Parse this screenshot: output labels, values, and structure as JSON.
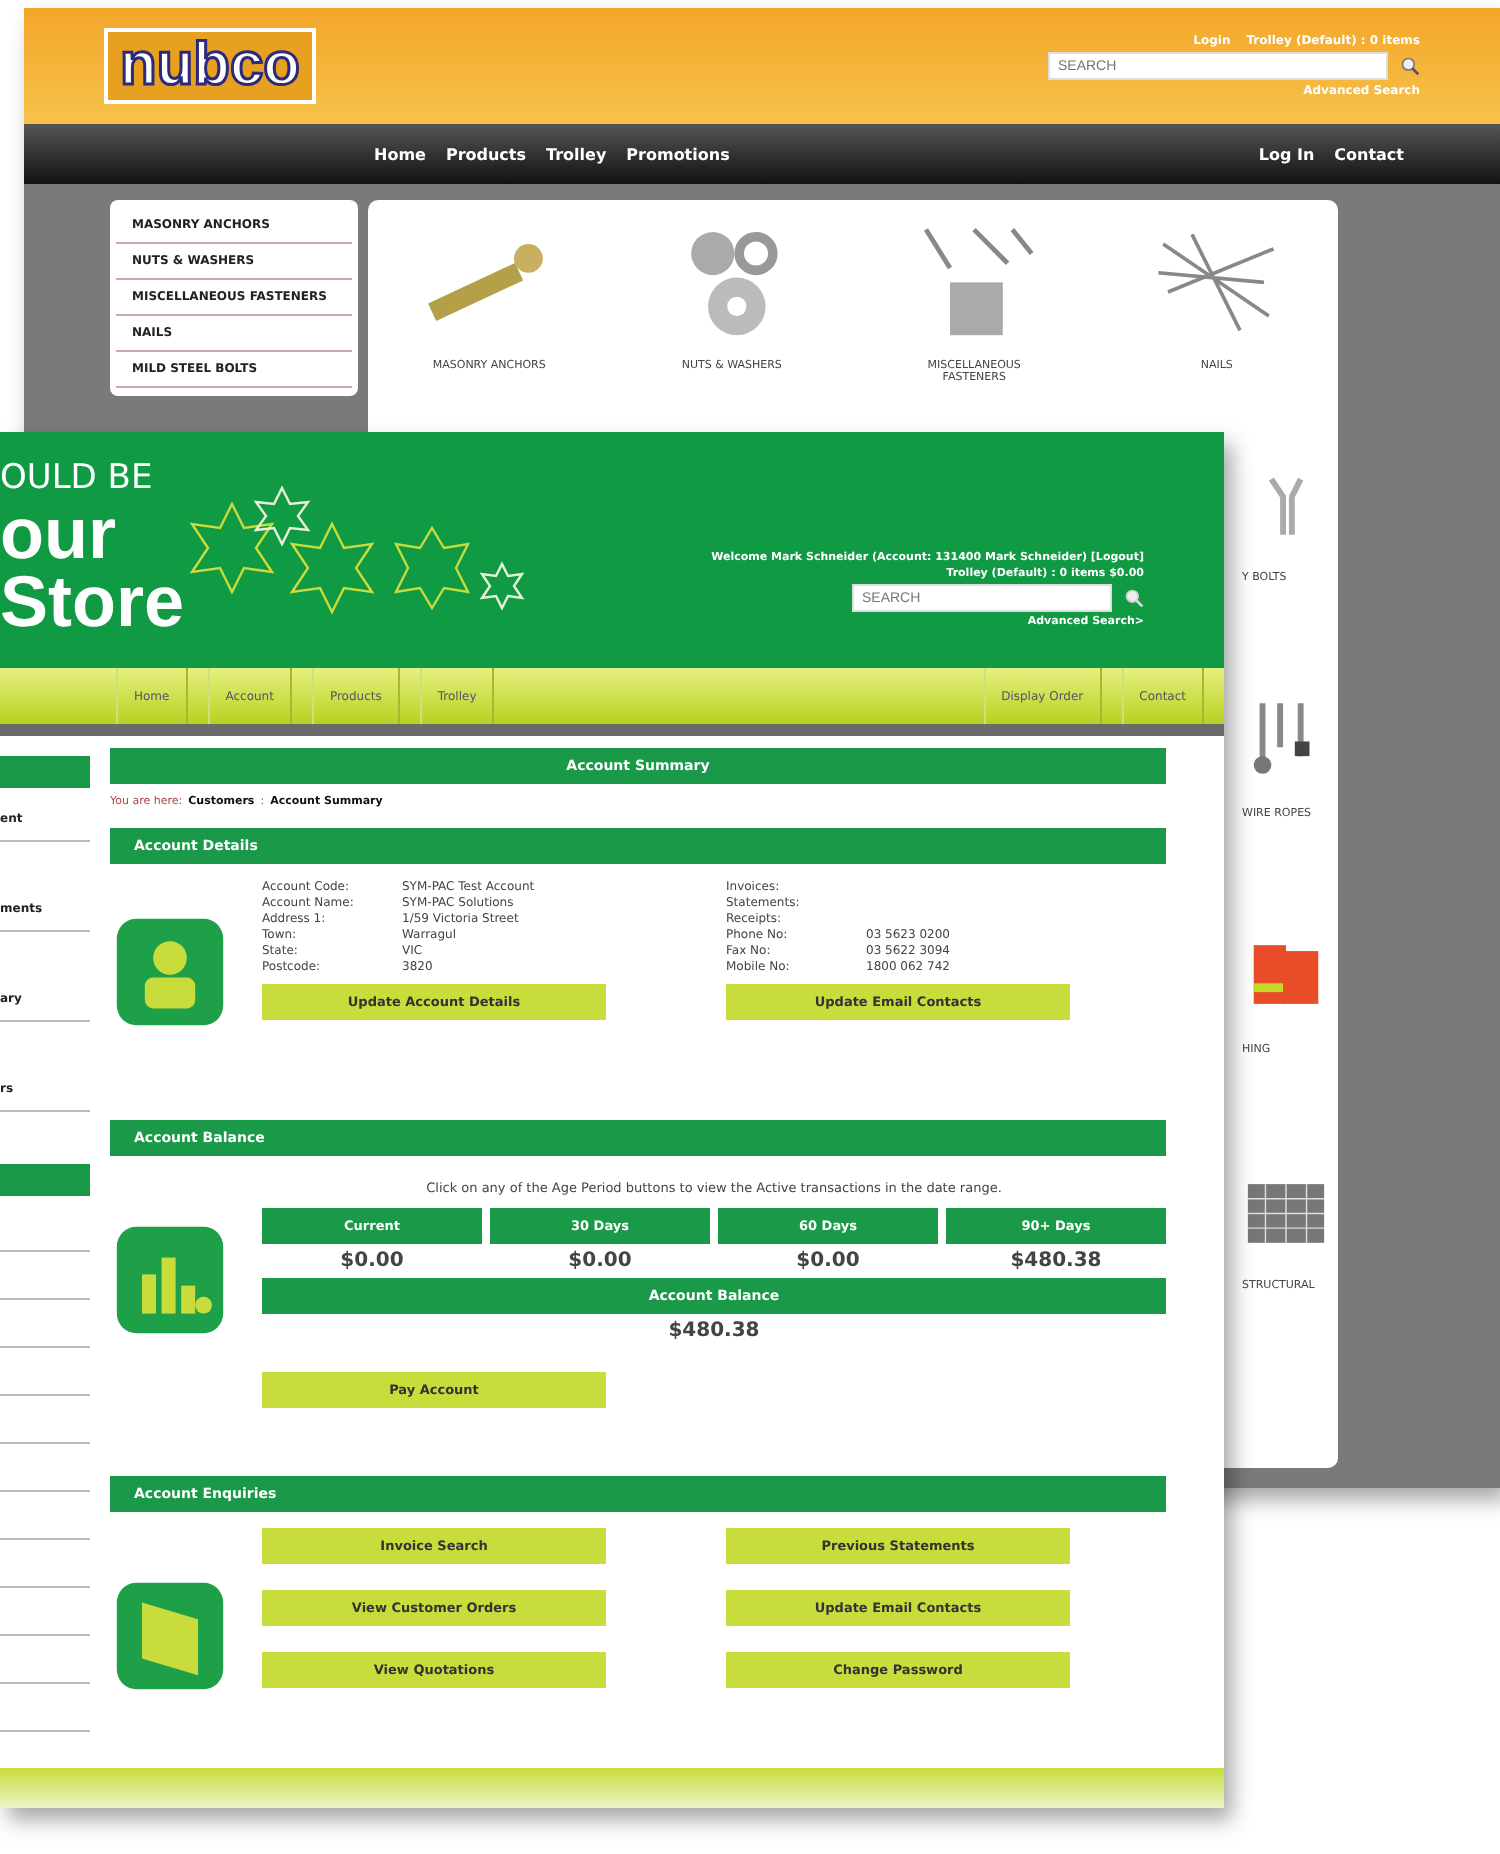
{
  "back_window": {
    "logo": "nubco",
    "header_links": [
      "Login",
      "Trolley (Default) : 0 items"
    ],
    "search": {
      "placeholder": "SEARCH"
    },
    "advanced_search": "Advanced Search",
    "nav_left": [
      "Home",
      "Products",
      "Trolley",
      "Promotions"
    ],
    "nav_right": [
      "Log In",
      "Contact"
    ],
    "sidebar": [
      "MASONRY ANCHORS",
      "NUTS & WASHERS",
      "MISCELLANEOUS FASTENERS",
      "NAILS",
      "MILD STEEL BOLTS"
    ],
    "products": [
      {
        "caption": "MASONRY ANCHORS",
        "kind": "anchor"
      },
      {
        "caption": "NUTS & WASHERS",
        "kind": "nut"
      },
      {
        "caption": "MISCELLANEOUS FASTENERS",
        "kind": "misc"
      },
      {
        "caption": "NAILS",
        "kind": "nails"
      },
      {
        "caption": "Y BOLTS",
        "kind": "bolts"
      },
      {
        "caption": "WIRE ROPES",
        "kind": "ropes"
      },
      {
        "caption": "HING",
        "kind": "clothing"
      },
      {
        "caption": "STRUCTURAL",
        "kind": "mesh"
      }
    ]
  },
  "front_window": {
    "banner": [
      "OULD BE",
      "our",
      "Store"
    ],
    "welcome": "Welcome Mark Schneider (Account: 131400 Mark Schneider) [Logout]",
    "trolley": "Trolley (Default) : 0 items  $0.00",
    "search": {
      "placeholder": "SEARCH"
    },
    "advanced_search": "Advanced Search>",
    "nav_left": [
      "Home",
      "Account",
      "Products",
      "Trolley"
    ],
    "nav_right": [
      "Display Order",
      "Contact"
    ],
    "sidebar": [
      "ent",
      "ments",
      "ary",
      "rs"
    ],
    "page_title": "Account Summary",
    "breadcrumb": {
      "prefix": "You are here:",
      "separator": ":",
      "trail": [
        "Customers",
        "Account Summary"
      ]
    },
    "details": {
      "title": "Account Details",
      "fields": [
        {
          "label": "Account Code:",
          "value": "SYM-PAC Test Account"
        },
        {
          "label": "Account Name:",
          "value": "SYM-PAC Solutions"
        },
        {
          "label": "Address 1:",
          "value": "1/59 Victoria Street"
        },
        {
          "label": "Town:",
          "value": "Warragul"
        },
        {
          "label": "State:",
          "value": "VIC"
        },
        {
          "label": "Postcode:",
          "value": "3820"
        }
      ],
      "contact_fields": [
        {
          "label": "Invoices:"
        },
        {
          "label": "Statements:"
        },
        {
          "label": "Receipts:"
        },
        {
          "label": "Phone No:",
          "value": "03 5623 0200"
        },
        {
          "label": "Fax No:",
          "value": "03 5622 3094"
        },
        {
          "label": "Mobile No:",
          "value": "1800 062 742"
        }
      ],
      "buttons": [
        "Update Account Details",
        "Update Email Contacts"
      ]
    },
    "balance": {
      "title": "Account Balance",
      "instruction": "Click on any of the Age Period buttons to view the Active transactions in the date range.",
      "periods": [
        {
          "label": "Current",
          "amount": "$0.00"
        },
        {
          "label": "30 Days",
          "amount": "$0.00"
        },
        {
          "label": "60 Days",
          "amount": "$0.00"
        },
        {
          "label": "90+ Days",
          "amount": "$480.38"
        }
      ],
      "total_label": "Account Balance",
      "total": "$480.38",
      "pay_button": "Pay Account"
    },
    "enquiries": {
      "title": "Account Enquiries",
      "buttons_left": [
        "Invoice Search",
        "View Customer Orders",
        "View Quotations"
      ],
      "buttons_right": [
        "Previous Statements",
        "Update Email Contacts",
        "Change Password"
      ]
    }
  }
}
